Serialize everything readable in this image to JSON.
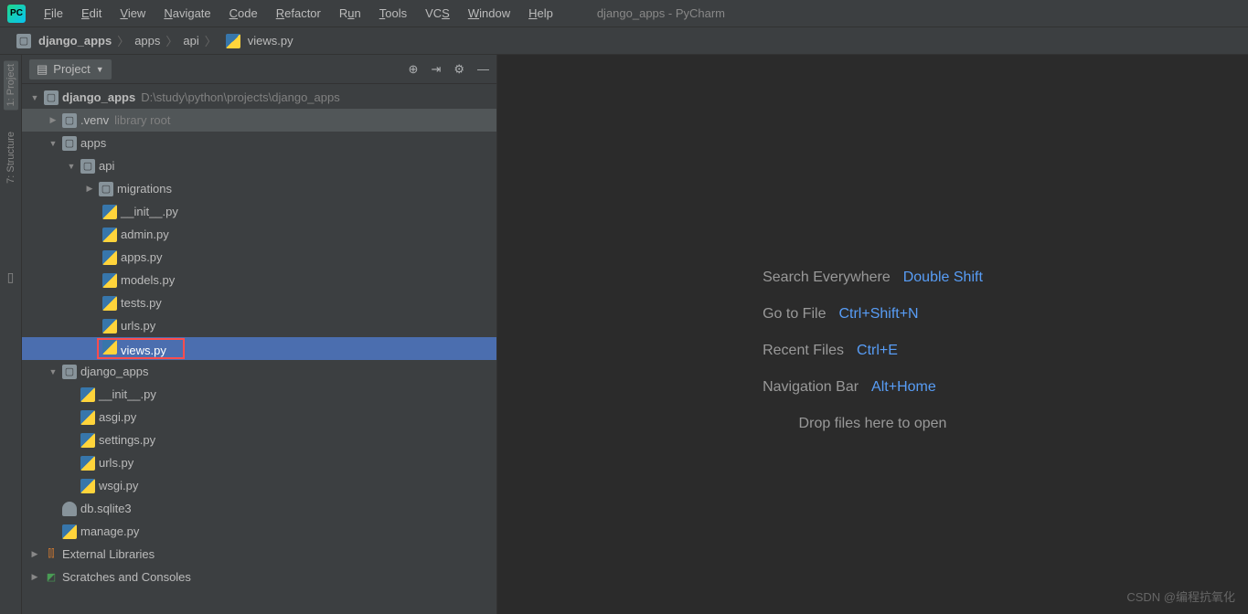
{
  "window": {
    "title": "django_apps - PyCharm"
  },
  "menu": [
    "File",
    "Edit",
    "View",
    "Navigate",
    "Code",
    "Refactor",
    "Run",
    "Tools",
    "VCS",
    "Window",
    "Help"
  ],
  "breadcrumbs": [
    {
      "label": "django_apps",
      "icon": "folder"
    },
    {
      "label": "apps",
      "icon": null
    },
    {
      "label": "api",
      "icon": null
    },
    {
      "label": "views.py",
      "icon": "py"
    }
  ],
  "gutter": [
    {
      "label": "1: Project",
      "active": true
    },
    {
      "label": "7: Structure",
      "active": false
    }
  ],
  "sidebar": {
    "title": "Project",
    "root": {
      "name": "django_apps",
      "path": "D:\\study\\python\\projects\\django_apps"
    },
    "venv": {
      "name": ".venv",
      "tag": "library root"
    },
    "apps": "apps",
    "api": "api",
    "migrations": "migrations",
    "api_files": [
      "__init__.py",
      "admin.py",
      "apps.py",
      "models.py",
      "tests.py",
      "urls.py",
      "views.py"
    ],
    "dj_pkg": "django_apps",
    "dj_files": [
      "__init__.py",
      "asgi.py",
      "settings.py",
      "urls.py",
      "wsgi.py"
    ],
    "db": "db.sqlite3",
    "manage": "manage.py",
    "ext": "External Libraries",
    "scr": "Scratches and Consoles"
  },
  "welcome": [
    {
      "label": "Search Everywhere",
      "key": "Double Shift"
    },
    {
      "label": "Go to File",
      "key": "Ctrl+Shift+N"
    },
    {
      "label": "Recent Files",
      "key": "Ctrl+E"
    },
    {
      "label": "Navigation Bar",
      "key": "Alt+Home"
    },
    {
      "label": "Drop files here to open",
      "key": ""
    }
  ],
  "watermark": "CSDN @编程抗氧化"
}
